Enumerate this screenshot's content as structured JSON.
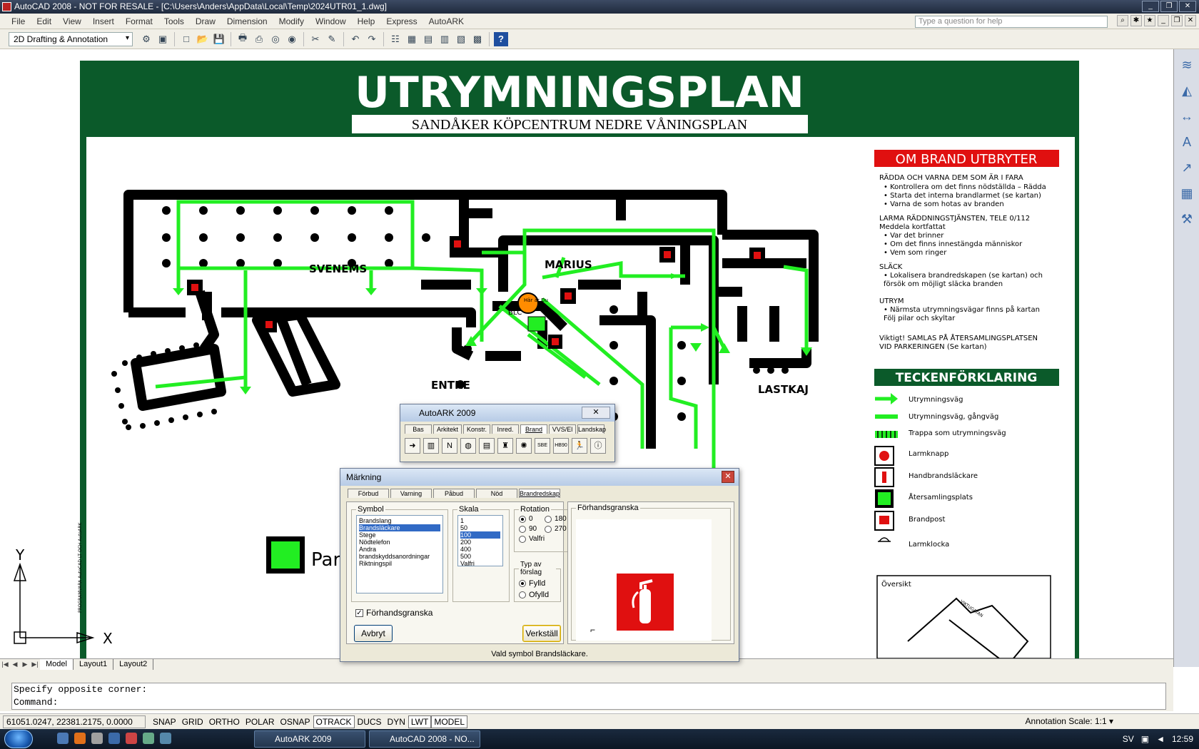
{
  "titlebar": {
    "title": "AutoCAD 2008 - NOT FOR RESALE - [C:\\Users\\Anders\\AppData\\Local\\Temp\\2024UTR01_1.dwg]"
  },
  "menu": {
    "items": [
      "File",
      "Edit",
      "View",
      "Insert",
      "Format",
      "Tools",
      "Draw",
      "Dimension",
      "Modify",
      "Window",
      "Help",
      "Express",
      "AutoARK"
    ],
    "help_placeholder": "Type a question for help"
  },
  "toolbar": {
    "workspace": "2D Drafting & Annotation"
  },
  "plan": {
    "title": "UTRYMNINGSPLAN",
    "subtitle": "SANDÅKER KÖPCENTRUM NEDRE VÅNINGSPLAN",
    "labels": {
      "svenems": "SVENEMS",
      "marius": "MARIUS",
      "entre": "ENTRE",
      "lastkaj": "LASTKAJ",
      "par": "Par",
      "blc": "BLC",
      "har_du": "Här är Du"
    },
    "side_text": "PROGRAMVARA AutoCAD LT OCH AutoARK",
    "brand": {
      "heading": "OM BRAND UTBRYTER",
      "l1": "RÄDDA OCH VARNA DEM SOM ÄR I FARA",
      "l2": "• Kontrollera om det finns nödställda – Rädda",
      "l3": "• Starta det interna brandlarmet (se kartan)",
      "l4": "• Varna de som hotas av branden",
      "l5": "LARMA RÄDDNINGSTJÄNSTEN, TELE 0/112",
      "l6": "Meddela kortfattat",
      "l7": "• Var det brinner",
      "l8": "• Om det finns innestängda människor",
      "l9": "• Vem som ringer",
      "l10": "SLÄCK",
      "l11": "• Lokalisera brandredskapen (se kartan) och",
      "l12": "  försök om möjligt släcka branden",
      "l13": "UTRYM",
      "l14": "• Närmsta utrymningsvägar finns på kartan",
      "l15": "  Följ pilar och skyltar",
      "l16": "Viktigt! SAMLAS PÅ ÅTERSAMLINGSPLATSEN",
      "l17": "VID PARKERINGEN (Se kartan)"
    },
    "legend": {
      "heading": "TECKENFÖRKLARING",
      "items": [
        "Utrymningsväg",
        "Utrymningsväg, gångväg",
        "Trappa som utrymningsväg",
        "Larmknapp",
        "Handbrandsläckare",
        "Återsamlingsplats",
        "Brandpost",
        "Larmklocka"
      ]
    },
    "overview": {
      "label": "Översikt",
      "street": "VIKTUGATAN"
    }
  },
  "axes": {
    "y": "Y",
    "x": "X"
  },
  "layout_tabs": [
    "Model",
    "Layout1",
    "Layout2"
  ],
  "command": {
    "line1": "Specify opposite corner:",
    "line2": "Command:"
  },
  "status": {
    "coords": "61051.0247, 22381.2175, 0.0000",
    "buttons": [
      "SNAP",
      "GRID",
      "ORTHO",
      "POLAR",
      "OSNAP",
      "OTRACK",
      "DUCS",
      "DYN",
      "LWT",
      "MODEL"
    ],
    "annotation_scale_label": "Annotation Scale:",
    "annotation_scale": "1:1"
  },
  "autoark": {
    "title": "AutoARK 2009",
    "tabs": [
      "Bas",
      "Arkitekt",
      "Konstr.",
      "Inred.",
      "Brand",
      "VVS/El",
      "Landskap"
    ],
    "icons": [
      "",
      "",
      "N",
      "",
      "",
      "",
      "",
      "SBE",
      "HB90",
      "",
      ""
    ]
  },
  "markning": {
    "title": "Märkning",
    "tabs": [
      "Förbud",
      "Varning",
      "Påbud",
      "Nöd",
      "Brandredskap"
    ],
    "symbol_label": "Symbol",
    "symbols": [
      "Brandslang",
      "Brandsläckare",
      "Stege",
      "Nödtelefon",
      "Andra brandskyddsanordningar",
      "Riktningspil"
    ],
    "skala_label": "Skala",
    "scales": [
      "1",
      "50",
      "100",
      "200",
      "400",
      "500",
      "Valfri"
    ],
    "rotation_label": "Rotation",
    "rot": {
      "r0": "0",
      "r180": "180",
      "r90": "90",
      "r270": "270",
      "valfri": "Valfri"
    },
    "typ_label": "Typ av förslag",
    "fylld": "Fylld",
    "ofylld": "Ofylld",
    "preview_check": "Förhandsgranska",
    "preview_group": "Förhandsgranska",
    "cancel": "Avbryt",
    "apply": "Verkställ",
    "status": "Vald symbol Brandsläckare."
  },
  "taskbar": {
    "task1": "AutoARK 2009",
    "task2": "AutoCAD 2008 - NO...",
    "lang": "SV",
    "clock": "12:59"
  },
  "colors": {
    "plan_green": "#0b5a2a",
    "exit_green": "#22ee22",
    "red": "#e01010"
  }
}
